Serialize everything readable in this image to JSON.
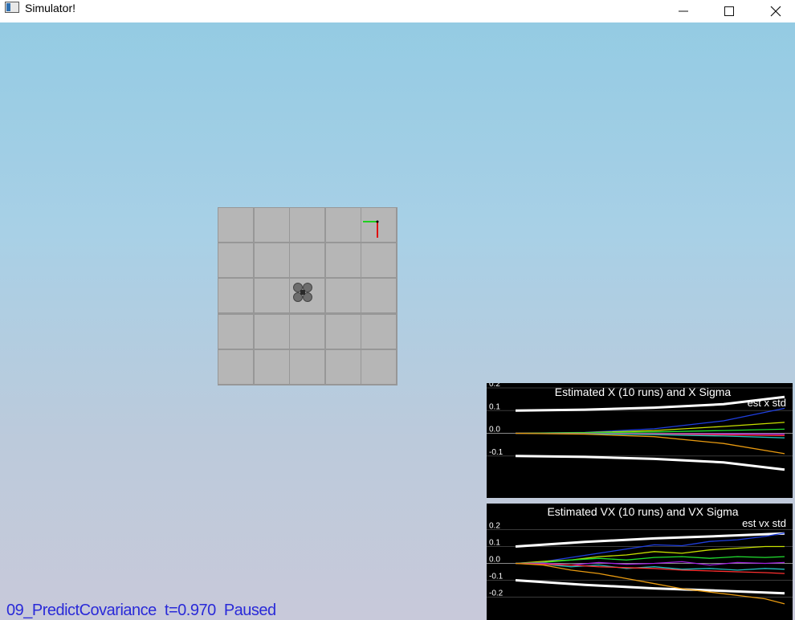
{
  "window": {
    "title": "Simulator!",
    "minimize_icon": "minimize-icon",
    "maximize_icon": "maximize-icon",
    "close_icon": "close-icon"
  },
  "status": {
    "scenario": "09_PredictCovariance",
    "time": "t=0.970",
    "state": "Paused"
  },
  "colors": {
    "sky_top": "#94cbe3",
    "sky_bottom": "#c8c9da",
    "status_text": "#2a2ad8",
    "plot_bg": "#000000"
  },
  "chart_data": [
    {
      "type": "line",
      "title": "Estimated X (10 runs) and X Sigma",
      "legend": [
        "est x std"
      ],
      "legend_placement": "top-right",
      "yticks": [
        "0.2",
        "0.1",
        "0.0",
        "-0.1"
      ],
      "ylim": [
        -0.2,
        0.2
      ],
      "series": [
        {
          "name": "est x std",
          "color": "#ffffff",
          "x": [
            0,
            0.25,
            0.5,
            0.75,
            0.97
          ],
          "values": [
            0.1,
            0.104,
            0.113,
            0.128,
            0.16
          ]
        },
        {
          "color": "#ffffff",
          "x": [
            0,
            0.25,
            0.5,
            0.75,
            0.97
          ],
          "values": [
            -0.1,
            -0.104,
            -0.113,
            -0.128,
            -0.16
          ]
        },
        {
          "color": "#1f3fe0",
          "x": [
            0,
            0.25,
            0.5,
            0.75,
            0.97
          ],
          "values": [
            0,
            0.004,
            0.02,
            0.055,
            0.11
          ]
        },
        {
          "color": "#c7e000",
          "x": [
            0,
            0.25,
            0.5,
            0.75,
            0.97
          ],
          "values": [
            0,
            0.003,
            0.012,
            0.03,
            0.048
          ]
        },
        {
          "color": "#22e030",
          "x": [
            0,
            0.25,
            0.5,
            0.75,
            0.97
          ],
          "values": [
            0,
            0.002,
            0.006,
            0.012,
            0.018
          ]
        },
        {
          "color": "#a020e0",
          "x": [
            0,
            0.25,
            0.5,
            0.75,
            0.97
          ],
          "values": [
            0,
            -0.001,
            -0.002,
            -0.003,
            -0.004
          ]
        },
        {
          "color": "#ff3030",
          "x": [
            0,
            0.25,
            0.5,
            0.75,
            0.97
          ],
          "values": [
            0,
            -0.001,
            -0.004,
            -0.007,
            -0.01
          ]
        },
        {
          "color": "#20c0c0",
          "x": [
            0,
            0.25,
            0.5,
            0.75,
            0.97
          ],
          "values": [
            0,
            -0.002,
            -0.006,
            -0.012,
            -0.02
          ]
        },
        {
          "color": "#e89a10",
          "x": [
            0,
            0.25,
            0.5,
            0.75,
            0.97
          ],
          "values": [
            0,
            -0.004,
            -0.015,
            -0.045,
            -0.09
          ]
        }
      ]
    },
    {
      "type": "line",
      "title": "Estimated VX (10 runs) and VX Sigma",
      "legend": [
        "est vx std"
      ],
      "legend_placement": "top-right",
      "yticks": [
        "0.2",
        "0.1",
        "0.0",
        "-0.1",
        "-0.2"
      ],
      "ylim": [
        -0.25,
        0.25
      ],
      "series": [
        {
          "name": "est vx std",
          "color": "#ffffff",
          "x": [
            0,
            0.25,
            0.5,
            0.75,
            0.97
          ],
          "values": [
            0.1,
            0.127,
            0.148,
            0.163,
            0.177
          ]
        },
        {
          "color": "#ffffff",
          "x": [
            0,
            0.25,
            0.5,
            0.75,
            0.97
          ],
          "values": [
            -0.1,
            -0.127,
            -0.148,
            -0.163,
            -0.177
          ]
        },
        {
          "color": "#1f3fe0",
          "x": [
            0,
            0.1,
            0.2,
            0.3,
            0.4,
            0.5,
            0.6,
            0.7,
            0.8,
            0.9,
            0.97
          ],
          "values": [
            0,
            0.01,
            0.035,
            0.06,
            0.085,
            0.11,
            0.105,
            0.13,
            0.14,
            0.16,
            0.18
          ]
        },
        {
          "color": "#c7e000",
          "x": [
            0,
            0.1,
            0.2,
            0.3,
            0.4,
            0.5,
            0.6,
            0.7,
            0.8,
            0.9,
            0.97
          ],
          "values": [
            0,
            0.012,
            0.02,
            0.04,
            0.05,
            0.07,
            0.06,
            0.08,
            0.09,
            0.1,
            0.1
          ]
        },
        {
          "color": "#22e030",
          "x": [
            0,
            0.1,
            0.2,
            0.3,
            0.4,
            0.5,
            0.6,
            0.7,
            0.8,
            0.9,
            0.97
          ],
          "values": [
            0,
            0.005,
            0.02,
            0.03,
            0.02,
            0.035,
            0.04,
            0.03,
            0.04,
            0.035,
            0.04
          ]
        },
        {
          "color": "#a020e0",
          "x": [
            0,
            0.1,
            0.2,
            0.3,
            0.4,
            0.5,
            0.6,
            0.7,
            0.8,
            0.9,
            0.97
          ],
          "values": [
            0,
            0.002,
            -0.01,
            0.005,
            -0.005,
            0.0,
            0.01,
            -0.01,
            0.005,
            0.0,
            0.005
          ]
        },
        {
          "color": "#20c0c0",
          "x": [
            0,
            0.1,
            0.2,
            0.3,
            0.4,
            0.5,
            0.6,
            0.7,
            0.8,
            0.9,
            0.97
          ],
          "values": [
            0,
            -0.005,
            -0.02,
            -0.01,
            -0.03,
            -0.02,
            -0.035,
            -0.03,
            -0.04,
            -0.03,
            -0.035
          ]
        },
        {
          "color": "#ff3030",
          "x": [
            0,
            0.1,
            0.2,
            0.3,
            0.4,
            0.5,
            0.6,
            0.7,
            0.8,
            0.9,
            0.97
          ],
          "values": [
            0,
            -0.005,
            -0.01,
            -0.02,
            -0.025,
            -0.03,
            -0.04,
            -0.045,
            -0.05,
            -0.055,
            -0.06
          ]
        },
        {
          "color": "#e89a10",
          "x": [
            0,
            0.1,
            0.2,
            0.3,
            0.4,
            0.5,
            0.6,
            0.7,
            0.8,
            0.9,
            0.97
          ],
          "values": [
            0,
            -0.01,
            -0.04,
            -0.06,
            -0.09,
            -0.12,
            -0.15,
            -0.17,
            -0.19,
            -0.21,
            -0.24
          ]
        }
      ]
    }
  ]
}
